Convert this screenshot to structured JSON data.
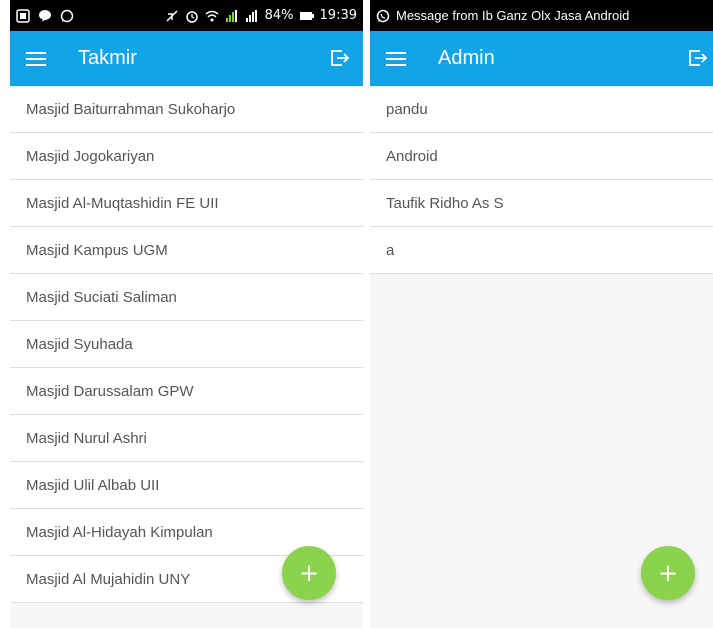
{
  "left": {
    "status_bar": {
      "battery": "84%",
      "time": "19:39"
    },
    "app_bar": {
      "title": "Takmir"
    },
    "items": [
      "Masjid Baiturrahman Sukoharjo",
      "Masjid Jogokariyan",
      "Masjid Al-Muqtashidin FE UII",
      "Masjid Kampus UGM",
      "Masjid Suciati Saliman",
      "Masjid Syuhada",
      "Masjid Darussalam GPW",
      "Masjid Nurul Ashri",
      "Masjid Ulil Albab UII",
      "Masjid Al-Hidayah Kimpulan",
      "Masjid Al Mujahidin UNY"
    ],
    "fab": {
      "label": "+"
    }
  },
  "right": {
    "status_bar": {
      "notification": "Message from Ib Ganz Olx Jasa Android"
    },
    "app_bar": {
      "title": "Admin"
    },
    "items": [
      "pandu",
      "Android",
      "Taufik Ridho As S",
      "a"
    ],
    "fab": {
      "label": "+"
    }
  },
  "colors": {
    "app_bar": "#12a4e6",
    "fab": "#8cd34d",
    "status_bar": "#000000"
  },
  "icons": [
    "menu-icon",
    "logout-icon",
    "add-icon",
    "whatsapp-icon",
    "wifi-icon",
    "signal-icon",
    "battery-icon"
  ]
}
